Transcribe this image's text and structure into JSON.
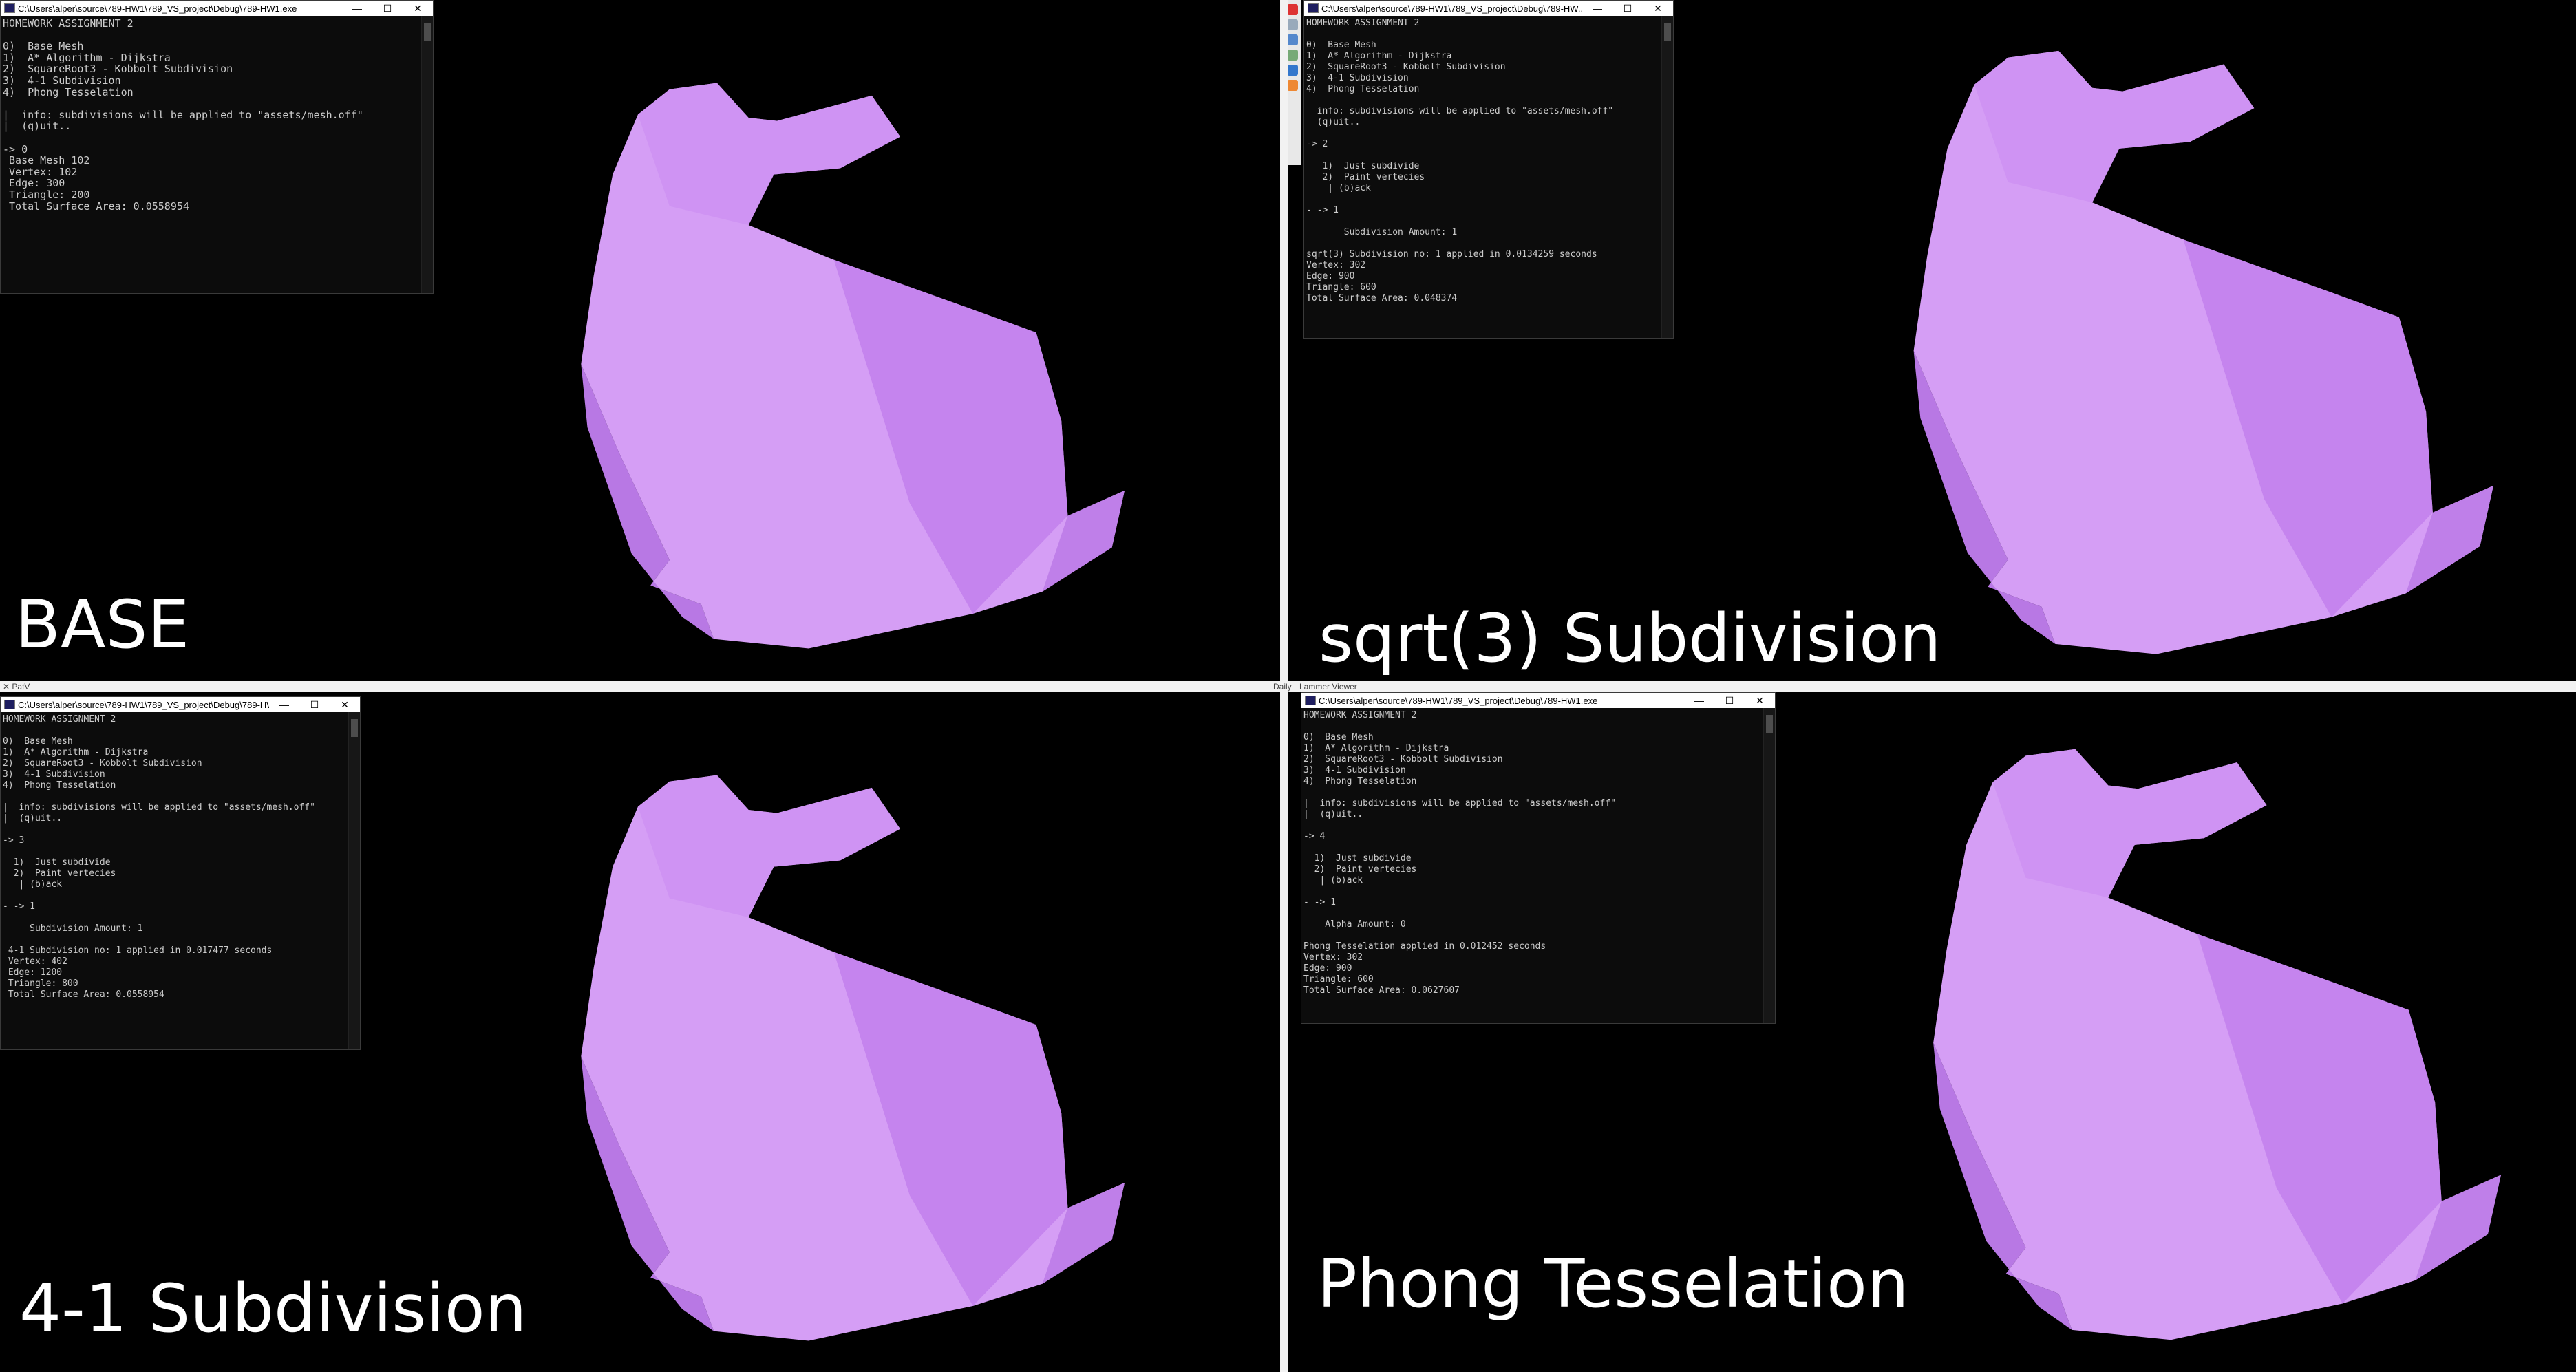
{
  "colors": {
    "bunny_fill": "#d59ef5",
    "bunny_shadow": "#9e5fc3",
    "background": "#000000"
  },
  "panels": [
    {
      "caption": "BASE",
      "console": {
        "title": "C:\\Users\\alper\\source\\789-HW1\\789_VS_project\\Debug\\789-HW1.exe",
        "lines": [
          "HOMEWORK ASSIGNMENT 2",
          "",
          "0)  Base Mesh",
          "1)  A* Algorithm - Dijkstra",
          "2)  SquareRoot3 - Kobbolt Subdivision",
          "3)  4-1 Subdivision",
          "4)  Phong Tesselation",
          "",
          "|  info: subdivisions will be applied to \"assets/mesh.off\"",
          "|  (q)uit..",
          "",
          "-> 0",
          " Base Mesh 102",
          " Vertex: 102",
          " Edge: 300",
          " Triangle: 200",
          " Total Surface Area: 0.0558954"
        ]
      }
    },
    {
      "caption": "sqrt(3) Subdivision",
      "console": {
        "title": "C:\\Users\\alper\\source\\789-HW1\\789_VS_project\\Debug\\789-HW...",
        "lines": [
          "HOMEWORK ASSIGNMENT 2",
          "",
          "0)  Base Mesh",
          "1)  A* Algorithm - Dijkstra",
          "2)  SquareRoot3 - Kobbolt Subdivision",
          "3)  4-1 Subdivision",
          "4)  Phong Tesselation",
          "",
          "  info: subdivisions will be applied to \"assets/mesh.off\"",
          "  (q)uit..",
          "",
          "-> 2",
          "",
          "   1)  Just subdivide",
          "   2)  Paint vertecies",
          "    | (b)ack",
          "",
          "- -> 1",
          "",
          "       Subdivision Amount: 1",
          "",
          "sqrt(3) Subdivision no: 1 applied in 0.0134259 seconds",
          "Vertex: 302",
          "Edge: 900",
          "Triangle: 600",
          "Total Surface Area: 0.048374"
        ]
      }
    },
    {
      "caption": "4-1 Subdivision",
      "console": {
        "title": "C:\\Users\\alper\\source\\789-HW1\\789_VS_project\\Debug\\789-HW...",
        "lines": [
          "HOMEWORK ASSIGNMENT 2",
          "",
          "0)  Base Mesh",
          "1)  A* Algorithm - Dijkstra",
          "2)  SquareRoot3 - Kobbolt Subdivision",
          "3)  4-1 Subdivision",
          "4)  Phong Tesselation",
          "",
          "|  info: subdivisions will be applied to \"assets/mesh.off\"",
          "|  (q)uit..",
          "",
          "-> 3",
          "",
          "  1)  Just subdivide",
          "  2)  Paint vertecies",
          "   | (b)ack",
          "",
          "- -> 1",
          "",
          "     Subdivision Amount: 1",
          "",
          " 4-1 Subdivision no: 1 applied in 0.017477 seconds",
          " Vertex: 402",
          " Edge: 1200",
          " Triangle: 800",
          " Total Surface Area: 0.0558954"
        ]
      }
    },
    {
      "caption": "Phong Tesselation",
      "console": {
        "title": "C:\\Users\\alper\\source\\789-HW1\\789_VS_project\\Debug\\789-HW1.exe",
        "lines": [
          "HOMEWORK ASSIGNMENT 2",
          "",
          "0)  Base Mesh",
          "1)  A* Algorithm - Dijkstra",
          "2)  SquareRoot3 - Kobbolt Subdivision",
          "3)  4-1 Subdivision",
          "4)  Phong Tesselation",
          "",
          "|  info: subdivisions will be applied to \"assets/mesh.off\"",
          "|  (q)uit..",
          "",
          "-> 4",
          "",
          "  1)  Just subdivide",
          "  2)  Paint vertecies",
          "   | (b)ack",
          "",
          "- -> 1",
          "",
          "    Alpha Amount: 0",
          "",
          "Phong Tesselation applied in 0.012452 seconds",
          "Vertex: 302",
          "Edge: 900",
          "Triangle: 600",
          "Total Surface Area: 0.0627607"
        ]
      }
    }
  ],
  "window_controls": {
    "minimize": "—",
    "maximize": "☐",
    "close": "✕"
  },
  "misc": {
    "daily_label": "Daily",
    "viewer_label": "Lammer Viewer",
    "pref_label": "✕ PatV"
  }
}
